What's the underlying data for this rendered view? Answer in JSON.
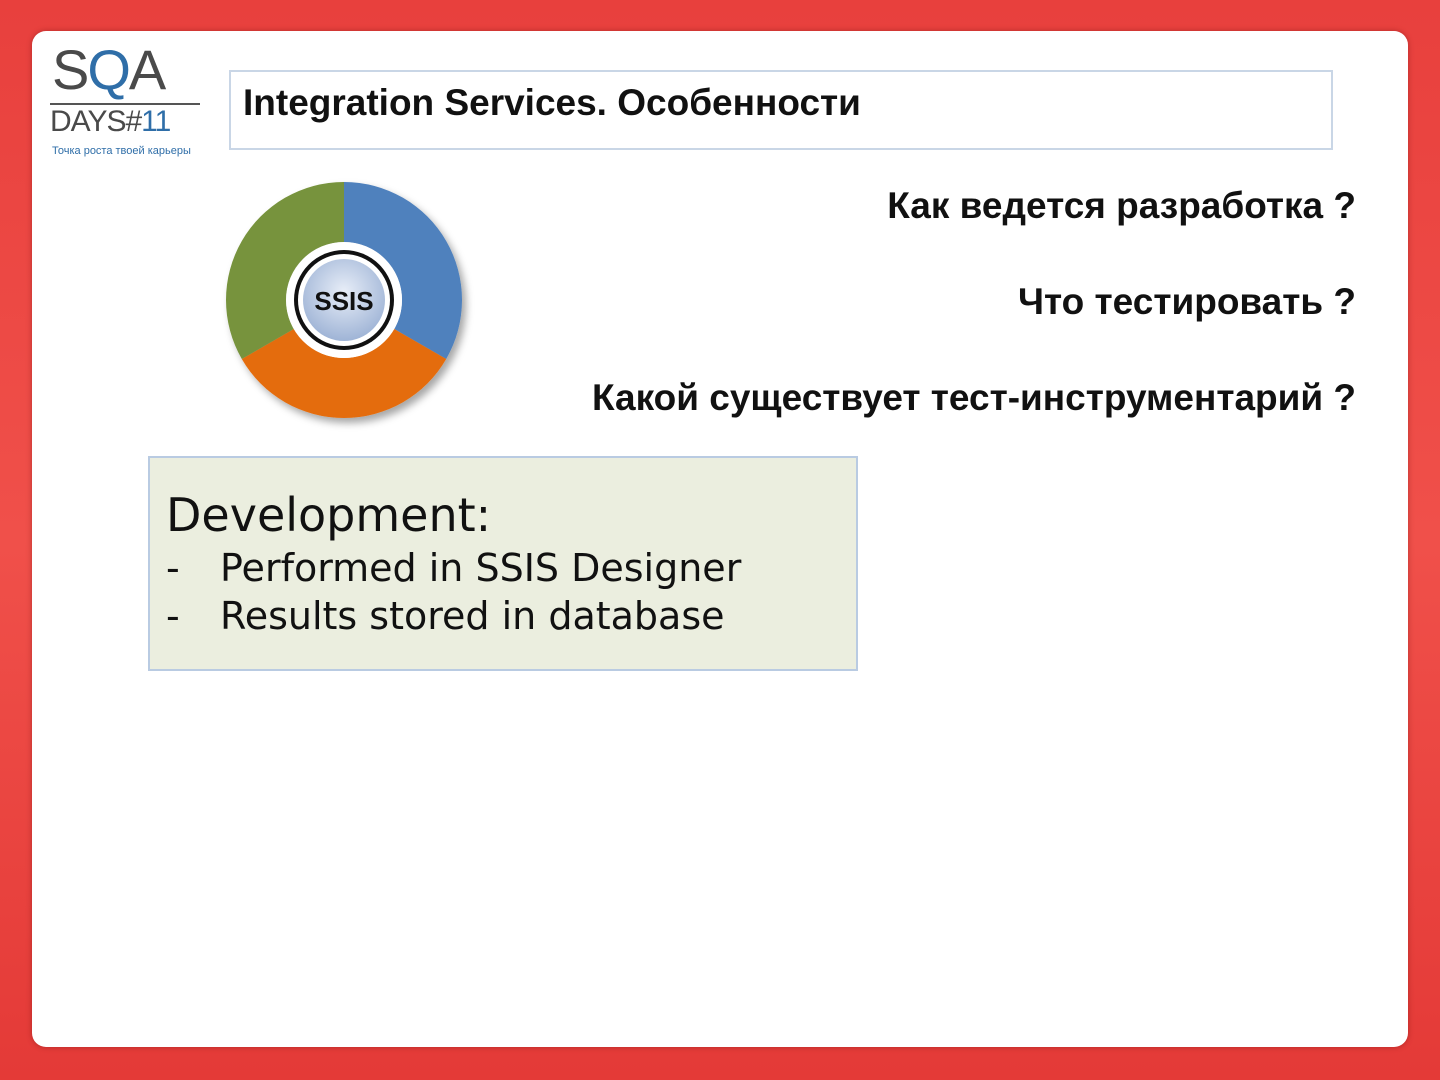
{
  "logo": {
    "sqa_prefix": "S",
    "sqa_q": "Q",
    "sqa_suffix": "A",
    "days": "DAYS#",
    "days_num": "11",
    "tagline": "Точка роста твоей карьеры"
  },
  "title": "Integration Services. Особенности",
  "diagram": {
    "center_label": "SSIS",
    "segment_colors": [
      "#4f81bd",
      "#e46c0a",
      "#77933c"
    ]
  },
  "questions": [
    "Как ведется разработка ?",
    "Что тестировать ?",
    "Какой существует тест-инструментарий ?"
  ],
  "development": {
    "heading": "Development:",
    "items": [
      "Performed in SSIS Designer",
      "Results stored in database"
    ],
    "bullet": "-"
  }
}
